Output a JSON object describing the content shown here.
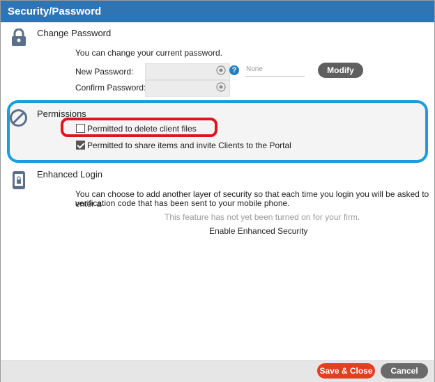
{
  "dialog": {
    "title": "Security/Password"
  },
  "change_password": {
    "title": "Change Password",
    "description": "You can change your current password.",
    "new_password_label": "New Password:",
    "confirm_password_label": "Confirm Password:",
    "new_password_value": "",
    "confirm_password_value": "",
    "help_label": "?",
    "hint_text": "None",
    "modify_label": "Modify",
    "lock_icon": "lock-icon",
    "eye_icon": "eye-icon"
  },
  "permissions": {
    "title": "Permissions",
    "icon": "no-entry-icon",
    "items": [
      {
        "label": "Permitted to delete client files",
        "checked": false
      },
      {
        "label": "Permitted to share items and invite Clients to the Portal",
        "checked": true
      }
    ]
  },
  "enhanced_login": {
    "title": "Enhanced Login",
    "icon": "mobile-lock-icon",
    "description_line1": "You can choose to add another layer of security so that each time you login you will be asked to enter a",
    "description_line2": "verification code that has been sent to your mobile phone.",
    "notice": "This feature has not yet been turned on for your firm.",
    "enable_label": "Enable Enhanced Security"
  },
  "footer": {
    "save_label": "Save & Close",
    "cancel_label": "Cancel"
  },
  "colors": {
    "titlebar": "#2e75b5",
    "highlight_blue": "#1a9ddd",
    "highlight_red": "#e0141c",
    "save_button": "#e0401e"
  }
}
